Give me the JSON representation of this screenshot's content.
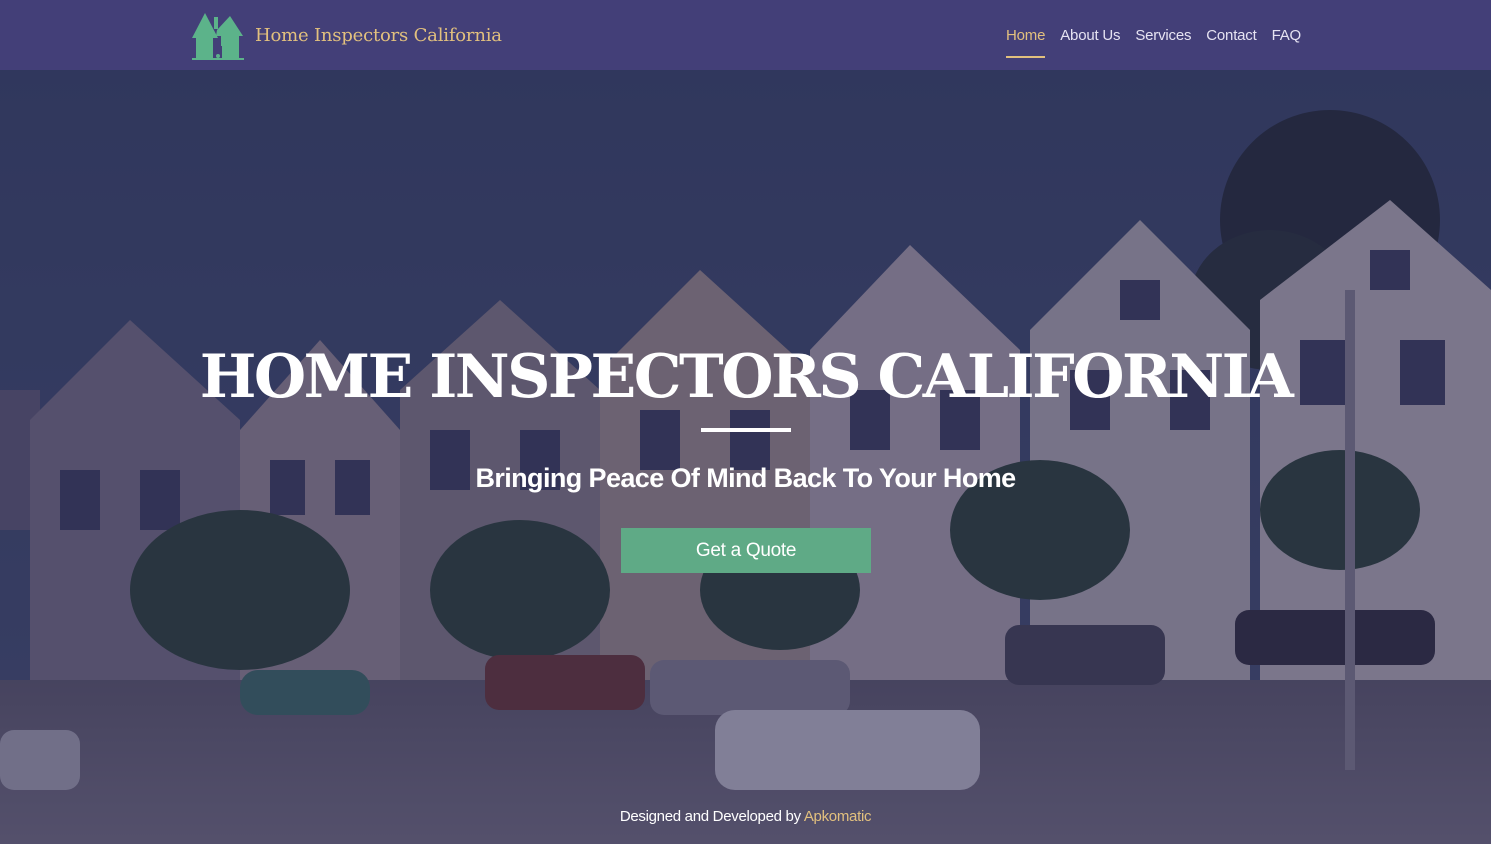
{
  "brand": {
    "name": "Home Inspectors California",
    "logo_icon": "house-icon"
  },
  "nav": {
    "items": [
      {
        "label": "Home",
        "active": true
      },
      {
        "label": "About Us",
        "active": false
      },
      {
        "label": "Services",
        "active": false
      },
      {
        "label": "Contact",
        "active": false
      },
      {
        "label": "FAQ",
        "active": false
      }
    ]
  },
  "hero": {
    "title": "HOME INSPECTORS CALIFORNIA",
    "subtitle": "Bringing Peace Of Mind Back To Your Home",
    "cta_label": "Get a Quote"
  },
  "footer": {
    "credit_prefix": "Designed and Developed by",
    "credit_link": "Apkomatic"
  },
  "colors": {
    "navbar_bg": "#433f78",
    "accent_gold": "#e2c07e",
    "button_green": "#5faa86",
    "logo_green": "#5cb38a"
  }
}
